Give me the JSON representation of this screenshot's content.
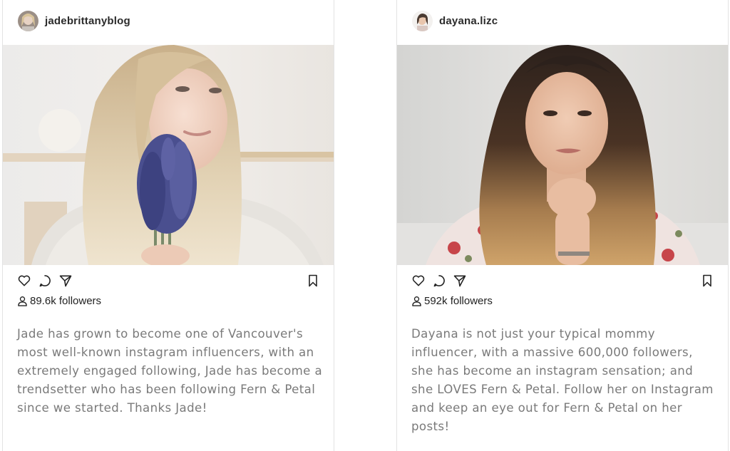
{
  "posts": [
    {
      "username": "jadebrittanyblog",
      "followers": "89.6k followers",
      "caption": "Jade has grown to become one of Vancouver's most well-known instagram influencers, with an extremely engaged following, Jade has become a trendsetter who has been following Fern & Petal since we started. Thanks Jade!",
      "icons": [
        "avatar",
        "heart-icon",
        "comment-icon",
        "share-icon",
        "bookmark-icon",
        "user-icon"
      ]
    },
    {
      "username": "dayana.lizc",
      "followers": "592k followers",
      "caption": "Dayana is not just your typical mommy influencer, with a massive 600,000 followers, she has become an instagram sensation; and she LOVES Fern & Petal. Follow her on Instagram and keep an eye out for Fern & Petal on her posts!",
      "icons": [
        "avatar",
        "heart-icon",
        "comment-icon",
        "share-icon",
        "bookmark-icon",
        "user-icon"
      ]
    }
  ],
  "colors": {
    "caption_text": "#7a7a7a",
    "border": "#e3e3e3",
    "lavender": "#4a4f8f"
  }
}
